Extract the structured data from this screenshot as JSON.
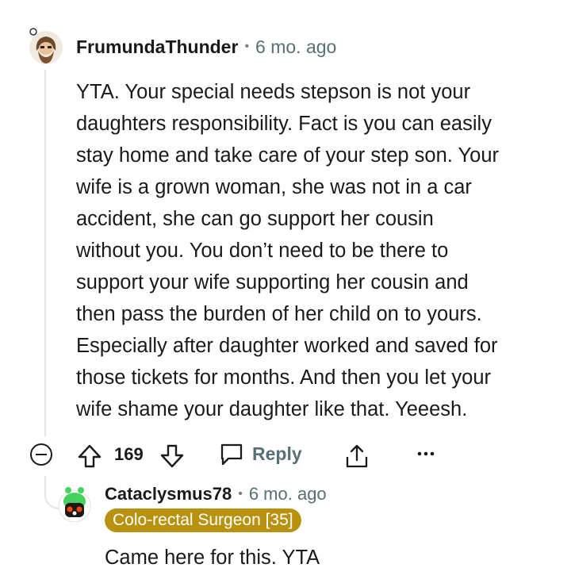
{
  "comment": {
    "username": "FrumundaThunder",
    "separator": "•",
    "time": "6 mo. ago",
    "avatar": "bearded-man-avatar-icon",
    "body_lines": [
      "YTA. Your special needs stepson is not your",
      "daughters responsibility. Fact is you can easily",
      "stay home and take care of your step son. Your",
      "wife is a grown woman, she was not in a car",
      "accident, she can go support her cousin",
      "without you. You don’t need to be there to",
      "support your wife supporting her cousin and",
      "then pass the burden of her child on to yours.",
      "Especially after daughter worked and saved for",
      "those tickets for months. And then you let your",
      "wife shame your daughter like that. Yeeesh."
    ],
    "votes": "169",
    "reply_label": "Reply",
    "icons": [
      "collapse-icon",
      "upvote-icon",
      "downvote-icon",
      "reply-icon",
      "share-icon",
      "more-icon"
    ]
  },
  "reply": {
    "username": "Cataclysmus78",
    "separator": "•",
    "time": "6 mo. ago",
    "flair": "Colo-rectal Surgeon [35]",
    "avatar": "green-robot-avatar-icon",
    "body": "Came here for this. YTA"
  },
  "colors": {
    "flair_bg": "#b8920e",
    "meta_text": "#576f76",
    "text": "#1a1a1b",
    "thread_line": "#e5e5e5"
  }
}
